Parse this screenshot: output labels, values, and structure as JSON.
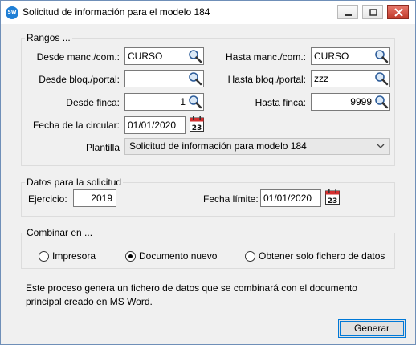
{
  "window": {
    "title": "Solicitud de información para el modelo 184",
    "icon_text": "SW"
  },
  "rangos": {
    "legend": "Rangos ...",
    "desde_manc_label": "Desde manc./com.:",
    "desde_manc_value": "CURSO",
    "hasta_manc_label": "Hasta manc./com.:",
    "hasta_manc_value": "CURSO",
    "desde_bloq_label": "Desde bloq./portal:",
    "desde_bloq_value": "",
    "hasta_bloq_label": "Hasta bloq./portal:",
    "hasta_bloq_value": "zzz",
    "desde_finca_label": "Desde finca:",
    "desde_finca_value": "1",
    "hasta_finca_label": "Hasta finca:",
    "hasta_finca_value": "9999",
    "fecha_circular_label": "Fecha de la circular:",
    "fecha_circular_value": "01/01/2020",
    "plantilla_label": "Plantilla",
    "plantilla_value": "Solicitud de información para modelo 184"
  },
  "solicitud": {
    "legend": "Datos para la solicitud",
    "ejercicio_label": "Ejercicio:",
    "ejercicio_value": "2019",
    "fecha_limite_label": "Fecha límite:",
    "fecha_limite_value": "01/01/2020"
  },
  "combinar": {
    "legend": "Combinar en ...",
    "options": [
      {
        "label": "Impresora",
        "selected": false
      },
      {
        "label": "Documento nuevo",
        "selected": true
      },
      {
        "label": "Obtener solo fichero de datos",
        "selected": false
      }
    ]
  },
  "calendar_day": "23",
  "note": "Este proceso genera un fichero de datos que se combinará con el documento principal creado en MS Word.",
  "buttons": {
    "generar": "Generar"
  },
  "colors": {
    "accent": "#0078d7",
    "calendar_red": "#d32f2f"
  }
}
